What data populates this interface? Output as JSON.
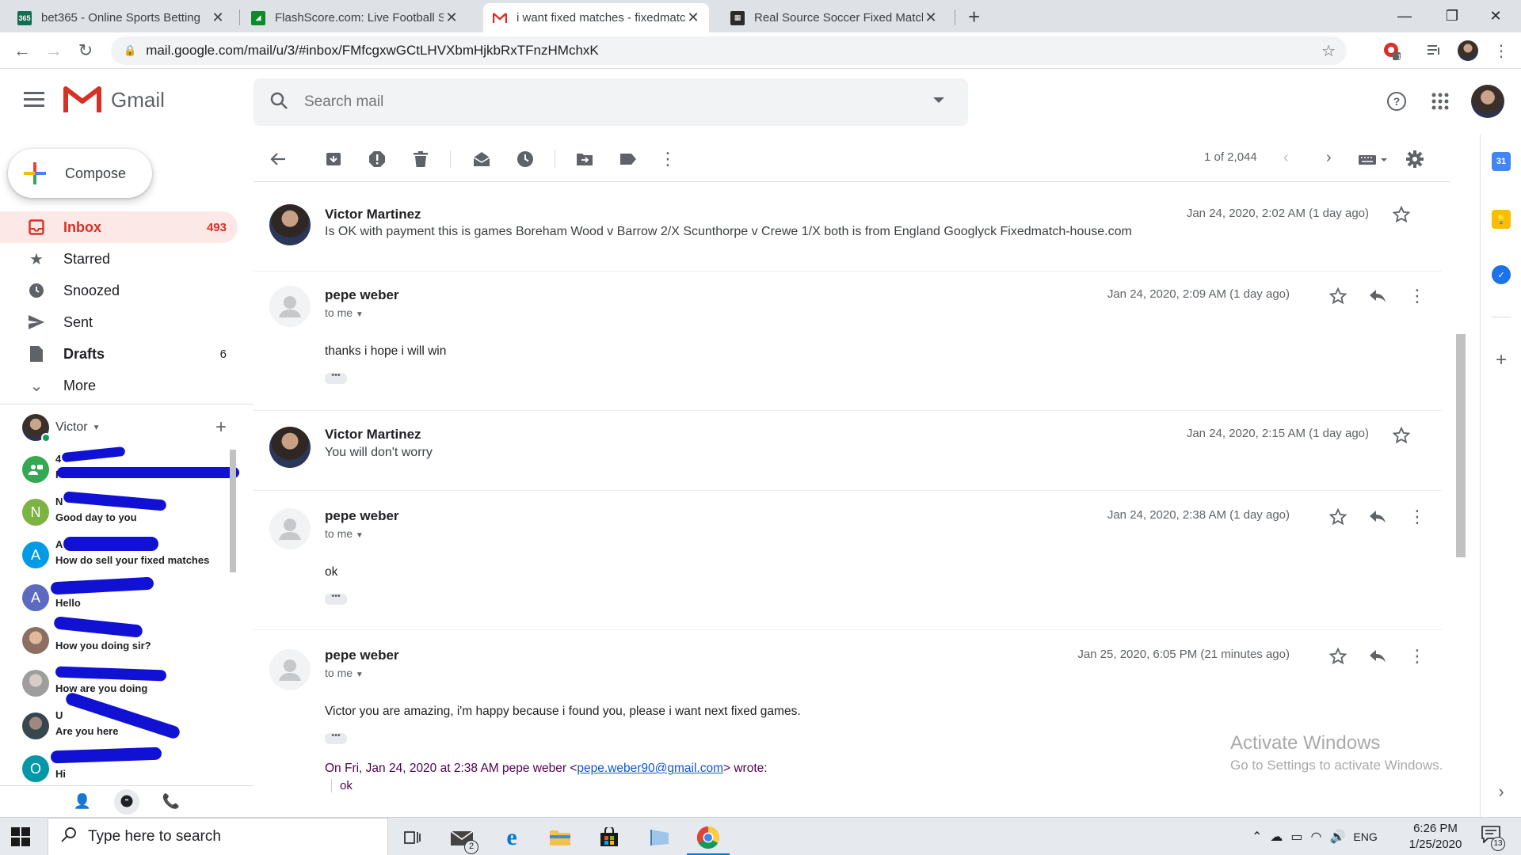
{
  "browser": {
    "tabs": [
      {
        "title": "bet365 - Online Sports Betting",
        "favicon": "bet365-favicon",
        "active": false
      },
      {
        "title": "FlashScore.com: Live Football Scores",
        "favicon": "flashscore-favicon",
        "active": false
      },
      {
        "title": "i want fixed matches - fixedmatch-house.com",
        "favicon": "gmail-favicon",
        "active": true
      },
      {
        "title": "Real Source Soccer Fixed Matches",
        "favicon": "site-favicon",
        "active": false
      }
    ],
    "url": "mail.google.com/mail/u/3/#inbox/FMfcgxwGCtLHVXbmHjkbRxTFnzHMchxK",
    "extension_badge": "1"
  },
  "gmail": {
    "logo_text": "Gmail",
    "search_placeholder": "Search mail",
    "compose_label": "Compose",
    "nav": [
      {
        "label": "Inbox",
        "count": "493",
        "icon": "inbox-icon",
        "active": true,
        "bold": true
      },
      {
        "label": "Starred",
        "count": "",
        "icon": "star-icon",
        "active": false,
        "bold": false
      },
      {
        "label": "Snoozed",
        "count": "",
        "icon": "clock-icon",
        "active": false,
        "bold": false
      },
      {
        "label": "Sent",
        "count": "",
        "icon": "send-icon",
        "active": false,
        "bold": false
      },
      {
        "label": "Drafts",
        "count": "6",
        "icon": "draft-icon",
        "active": false,
        "bold": true
      },
      {
        "label": "More",
        "count": "",
        "icon": "chevron-down-icon",
        "active": false,
        "bold": false
      }
    ],
    "hangouts_user": "Victor",
    "chats": [
      {
        "initial": "",
        "name": "4",
        "message": "F",
        "color": "#34a853"
      },
      {
        "initial": "N",
        "name": "N",
        "message": "Good day to you",
        "color": "#7cb342"
      },
      {
        "initial": "A",
        "name": "A",
        "message": "How do sell your fixed matches",
        "color": "#039be5"
      },
      {
        "initial": "A",
        "name": "",
        "message": "Hello",
        "color": "#5c6bc0"
      },
      {
        "initial": "",
        "name": "",
        "message": "How you doing sir?",
        "color": "#a1887f"
      },
      {
        "initial": "",
        "name": "",
        "message": "How are you doing",
        "color": "#bdbdbd"
      },
      {
        "initial": "",
        "name": "U",
        "message": "Are you here",
        "color": "#546e7a"
      },
      {
        "initial": "O",
        "name": "",
        "message": "Hi",
        "color": "#0097a7"
      }
    ],
    "pager": "1 of 2,044",
    "messages": [
      {
        "sender": "Victor Martinez",
        "collapsed": true,
        "snippet": "Is OK with payment this is games Boreham Wood v Barrow 2/X Scunthorpe v Crewe 1/X both is from England Googlyck Fixedmatch-house.com",
        "date": "Jan 24, 2020, 2:02 AM (1 day ago)",
        "avatar": "photo"
      },
      {
        "sender": "pepe weber",
        "collapsed": false,
        "to": "to me",
        "body": "thanks i hope i will win",
        "date": "Jan 24, 2020, 2:09 AM (1 day ago)",
        "avatar": "generic"
      },
      {
        "sender": "Victor Martinez",
        "collapsed": true,
        "snippet": "You will don't worry",
        "date": "Jan 24, 2020, 2:15 AM (1 day ago)",
        "avatar": "photo"
      },
      {
        "sender": "pepe weber",
        "collapsed": false,
        "to": "to me",
        "body": "ok",
        "date": "Jan 24, 2020, 2:38 AM (1 day ago)",
        "avatar": "generic"
      },
      {
        "sender": "pepe weber",
        "collapsed": false,
        "to": "to me",
        "body": "Victor you are amazing, i'm happy because i found you, please i want next fixed games.",
        "date": "Jan 25, 2020, 6:05 PM (21 minutes ago)",
        "avatar": "generic",
        "quote_prefix": "On Fri, Jan 24, 2020 at 2:38 AM pepe weber <",
        "quote_email": "pepe.weber90@gmail.com",
        "quote_suffix": "> wrote:",
        "quote_body": "ok"
      }
    ]
  },
  "watermark": {
    "title": "Activate Windows",
    "subtitle": "Go to Settings to activate Windows."
  },
  "taskbar": {
    "search_placeholder": "Type here to search",
    "mail_badge": "2",
    "language": "ENG",
    "time": "6:26 PM",
    "date": "1/25/2020",
    "notification_count": "13"
  },
  "colors": {
    "gmail_red": "#d93025",
    "inbox_highlight": "#fce8e6",
    "link_blue": "#1155cc",
    "quote_purple": "#500050",
    "scribble_blue": "#1111d4"
  }
}
